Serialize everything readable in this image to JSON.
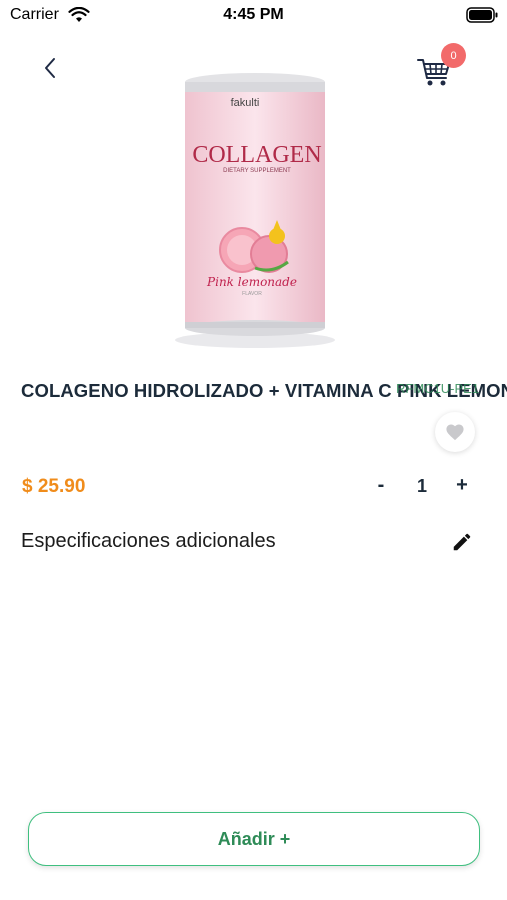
{
  "status_bar": {
    "carrier": "Carrier",
    "time": "4:45 PM"
  },
  "header": {
    "back_icon": "chevron-left-icon",
    "cart_icon": "shopping-cart-icon",
    "cart_count": "0",
    "badge_color": "#f26a6a"
  },
  "product": {
    "image": {
      "brand": "fakulti",
      "name": "COLLAGEN",
      "subtitle": "DIETARY SUPPLEMENT",
      "flavor": "Pink lemonade",
      "flavor_sub": "FLAVOR"
    },
    "title": "COLAGENO HIDROLIZADO + VITAMINA C PINK LEMONADE",
    "sku": "RFMC1U-PE1",
    "price": "$ 25.90",
    "price_color": "#f08c1b",
    "quantity": "1",
    "minus_label": "-",
    "plus_label": "+",
    "favorite_icon": "heart-icon"
  },
  "specs": {
    "label": "Especificaciones adicionales",
    "edit_icon": "pencil-icon"
  },
  "footer": {
    "add_label": "Añadir +",
    "accent_color": "#3fbf7f"
  }
}
